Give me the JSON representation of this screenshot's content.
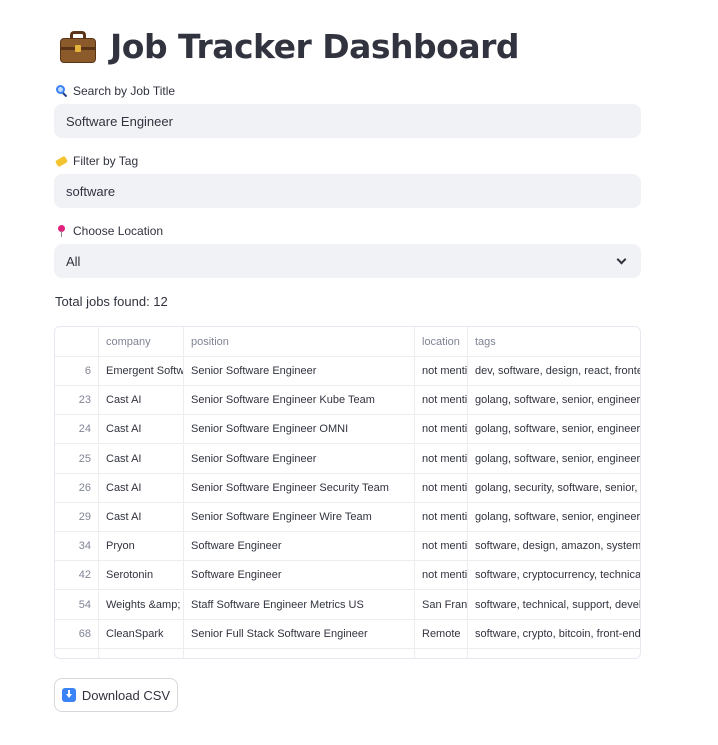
{
  "header": {
    "title": "Job Tracker Dashboard",
    "icon": "briefcase-icon"
  },
  "search": {
    "label": "Search by Job Title",
    "icon": "magnifier-icon",
    "value": "Software Engineer"
  },
  "tag_filter": {
    "label": "Filter by Tag",
    "icon": "tag-icon",
    "value": "software"
  },
  "location": {
    "label": "Choose Location",
    "icon": "pin-icon",
    "selected": "All"
  },
  "summary": {
    "total_text": "Total jobs found: 12"
  },
  "table": {
    "columns": [
      "",
      "company",
      "position",
      "location",
      "tags"
    ],
    "rows": [
      [
        "6",
        "Emergent Software",
        "Senior Software Engineer",
        "not mentioned",
        "dev, software, design, react, frontend"
      ],
      [
        "23",
        "Cast AI",
        "Senior Software Engineer Kube Team",
        "not mentioned",
        "golang, software, senior, engineer"
      ],
      [
        "24",
        "Cast AI",
        "Senior Software Engineer OMNI",
        "not mentioned",
        "golang, software, senior, engineer"
      ],
      [
        "25",
        "Cast AI",
        "Senior Software Engineer",
        "not mentioned",
        "golang, software, senior, engineer"
      ],
      [
        "26",
        "Cast AI",
        "Senior Software Engineer Security Team",
        "not mentioned",
        "golang, security, software, senior, engineer"
      ],
      [
        "29",
        "Cast AI",
        "Senior Software Engineer Wire Team",
        "not mentioned",
        "golang, software, senior, engineer"
      ],
      [
        "34",
        "Pryon",
        "Software Engineer",
        "not mentioned",
        "software, design, amazon, system, engineer"
      ],
      [
        "42",
        "Serotonin",
        "Software Engineer",
        "not mentioned",
        "software, cryptocurrency, technical, engineer"
      ],
      [
        "54",
        "Weights &amp; Biases",
        "Staff Software Engineer Metrics US",
        "San Francisco",
        "software, technical, support, developer"
      ],
      [
        "68",
        "CleanSpark",
        "Senior Full Stack Software Engineer",
        "Remote",
        "software, crypto, bitcoin, front-end"
      ],
      [
        "",
        "",
        "",
        "",
        ""
      ]
    ]
  },
  "download": {
    "label": "Download CSV",
    "icon": "download-icon"
  }
}
